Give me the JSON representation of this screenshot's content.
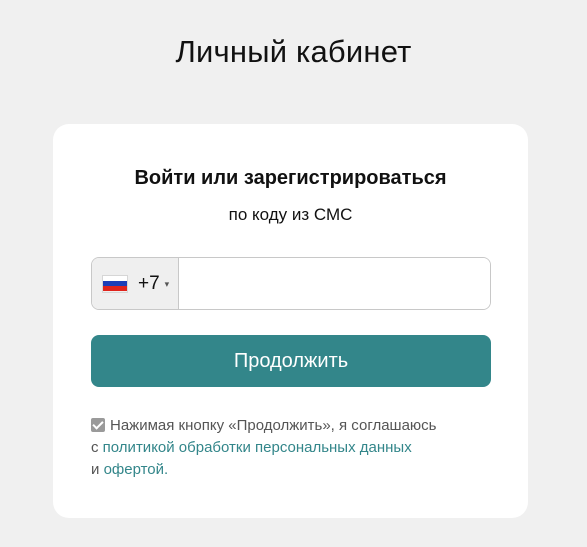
{
  "page": {
    "title": "Личный кабинет"
  },
  "card": {
    "title": "Войти или зарегистрироваться",
    "subtitle": "по коду из СМС"
  },
  "phone": {
    "country_flag": "russia-flag-icon",
    "dial_code": "+7",
    "caret": "▾",
    "value": "",
    "placeholder": ""
  },
  "actions": {
    "continue_label": "Продолжить"
  },
  "consent": {
    "checked": true,
    "line1": "Нажимая кнопку «Продолжить», я соглашаюсь",
    "line2_prefix": "с",
    "privacy_link": "политикой обработки персональных данных",
    "line3_prefix": "и",
    "offer_link": "офертой",
    "suffix": "."
  },
  "colors": {
    "background": "#f0f0f0",
    "card": "#ffffff",
    "accent": "#33868a",
    "text": "#111111",
    "muted_text": "#555555"
  }
}
